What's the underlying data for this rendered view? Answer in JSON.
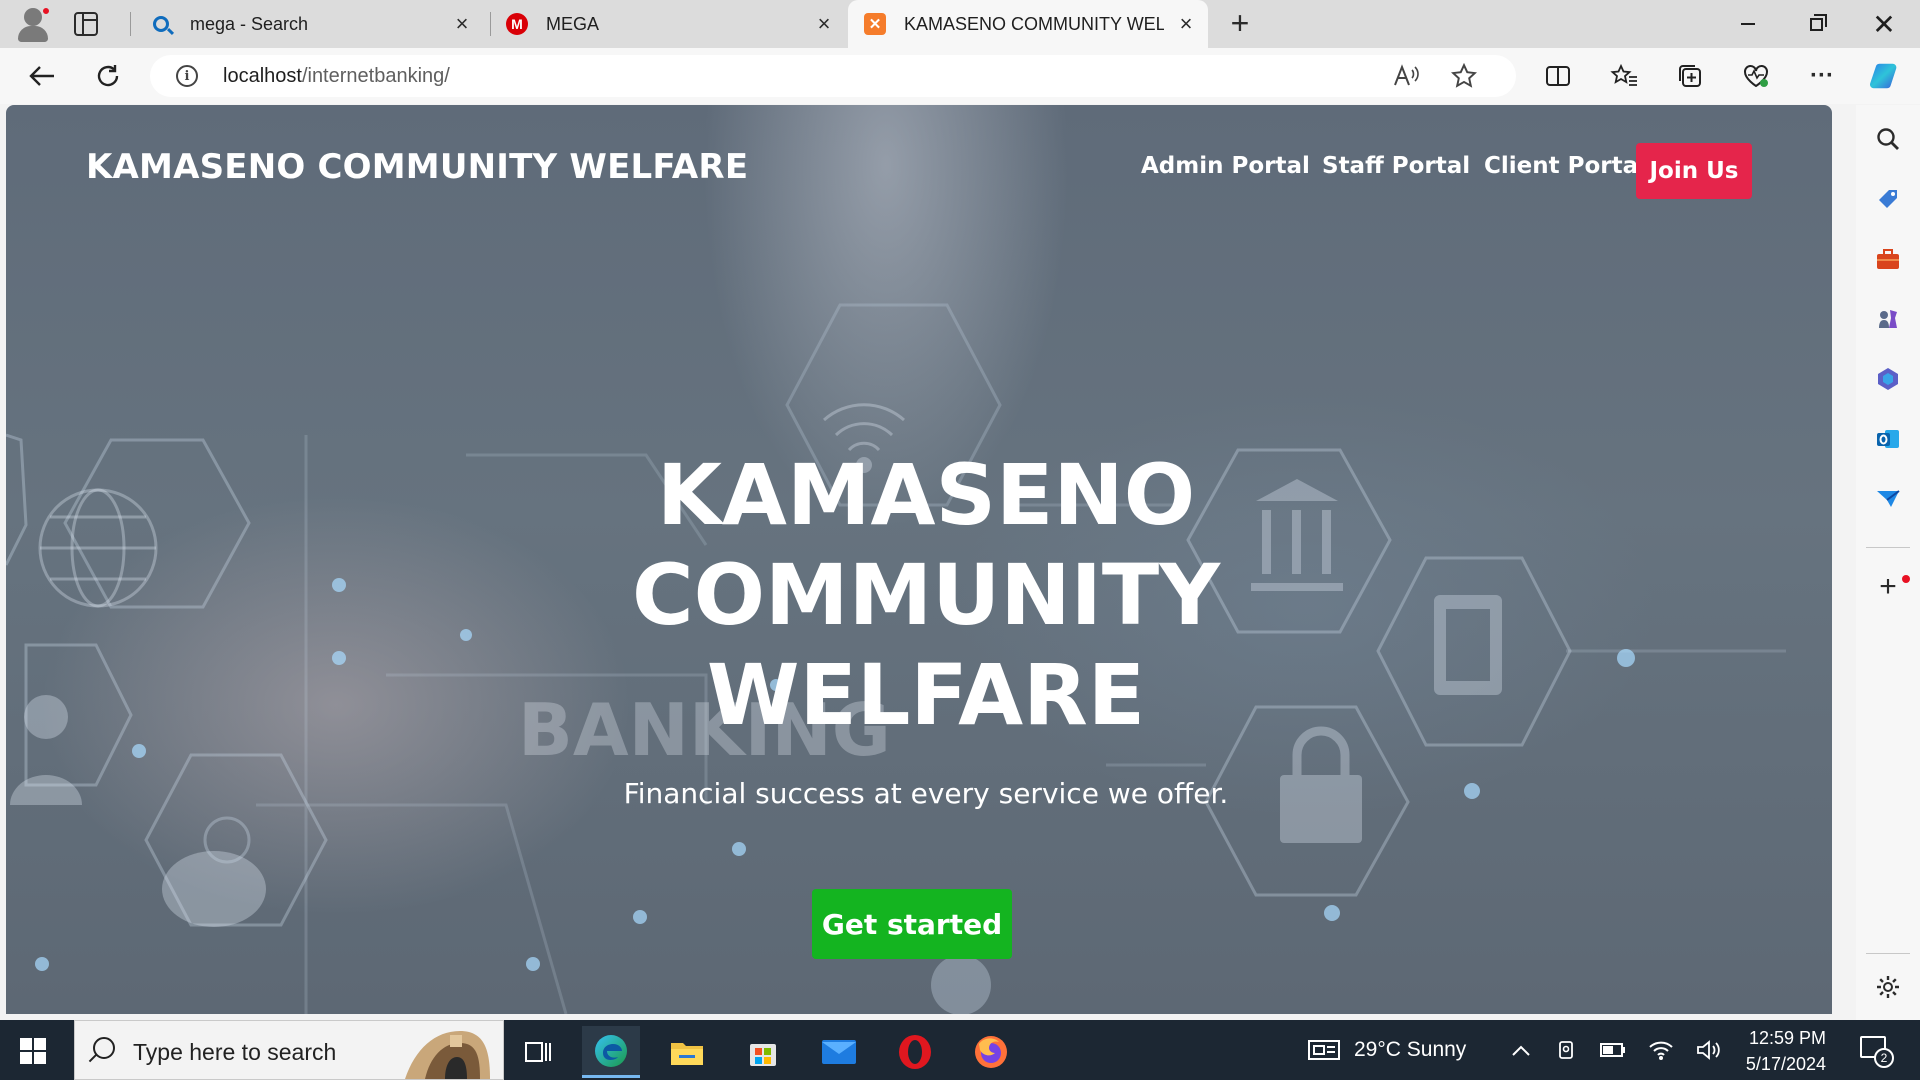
{
  "browser": {
    "tabs": [
      {
        "title": "mega - Search",
        "icon": "search-icon",
        "active": false
      },
      {
        "title": "MEGA",
        "icon": "mega-icon",
        "active": false
      },
      {
        "title": "KAMASENO COMMUNITY WELFA",
        "icon": "xampp-icon",
        "active": true
      }
    ],
    "favicon_letters": {
      "mega": "M",
      "xampp": "✕"
    },
    "url": {
      "host": "localhost",
      "path": "/internetbanking/"
    }
  },
  "page": {
    "brand": "KAMASENO COMMUNITY WELFARE",
    "nav": {
      "admin": "Admin Portal",
      "staff": "Staff Portal",
      "client": "Client Portal",
      "join": "Join Us"
    },
    "hero": {
      "title_line1": "KAMASENO",
      "title_line2": "COMMUNITY",
      "title_line3": "WELFARE",
      "subtitle": "Financial success at every service we offer.",
      "cta": "Get started"
    },
    "background_text": "BANKING",
    "colors": {
      "join_button": "#e5254b",
      "cta_button": "#14b420",
      "overlay": "#5f6b79"
    }
  },
  "taskbar": {
    "search_placeholder": "Type here to search",
    "weather": "29°C  Sunny",
    "time": "12:59 PM",
    "date": "5/17/2024",
    "notification_count": "2"
  }
}
